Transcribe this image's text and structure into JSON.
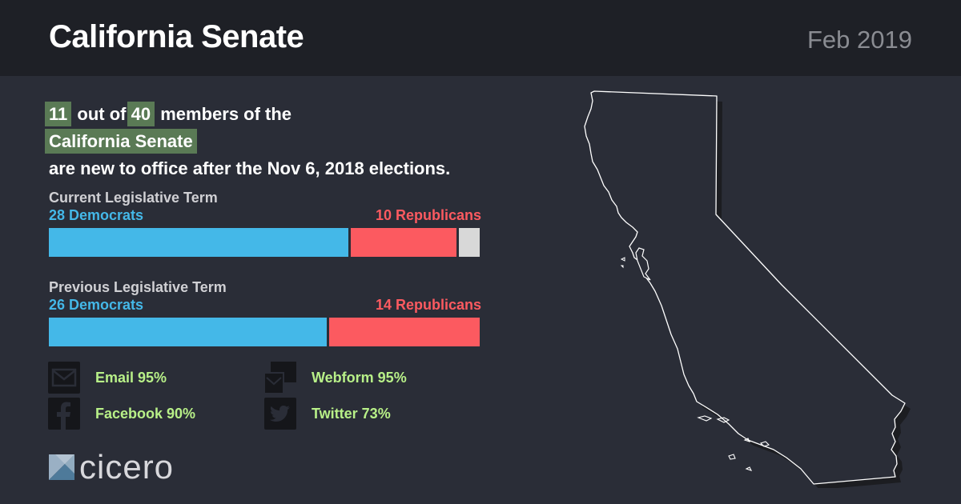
{
  "header": {
    "title": "California Senate",
    "date": "Feb 2019"
  },
  "headline": {
    "new_count": "11",
    "out_of_text": "out of",
    "total": "40",
    "members_text": "members of the",
    "chamber": "California Senate",
    "tail": "are new to office after the Nov 6, 2018 elections."
  },
  "current_term": {
    "title": "Current Legislative Term",
    "democrats_label": "28 Democrats",
    "republicans_label": "10 Republicans",
    "democrats": 28,
    "republicans": 10,
    "vacant": 2,
    "total": 40
  },
  "previous_term": {
    "title": "Previous Legislative Term",
    "democrats_label": "26 Democrats",
    "republicans_label": "14 Republicans",
    "democrats": 26,
    "republicans": 14,
    "vacant": 0,
    "total": 40
  },
  "contacts": [
    {
      "label": "Email 95%",
      "icon": "email-icon",
      "percent": 95
    },
    {
      "label": "Webform 95%",
      "icon": "webform-icon",
      "percent": 95
    },
    {
      "label": "Facebook 90%",
      "icon": "facebook-icon",
      "percent": 90
    },
    {
      "label": "Twitter 73%",
      "icon": "twitter-icon",
      "percent": 73
    }
  ],
  "logo": {
    "text": "cicero"
  },
  "colors": {
    "democrat": "#44b8e8",
    "republican": "#fc5a60",
    "vacant": "#d8d8d8",
    "highlight": "#5a7a55",
    "contact_text": "#b8f088",
    "background": "#2a2d37",
    "header_bg": "#1e2026"
  }
}
